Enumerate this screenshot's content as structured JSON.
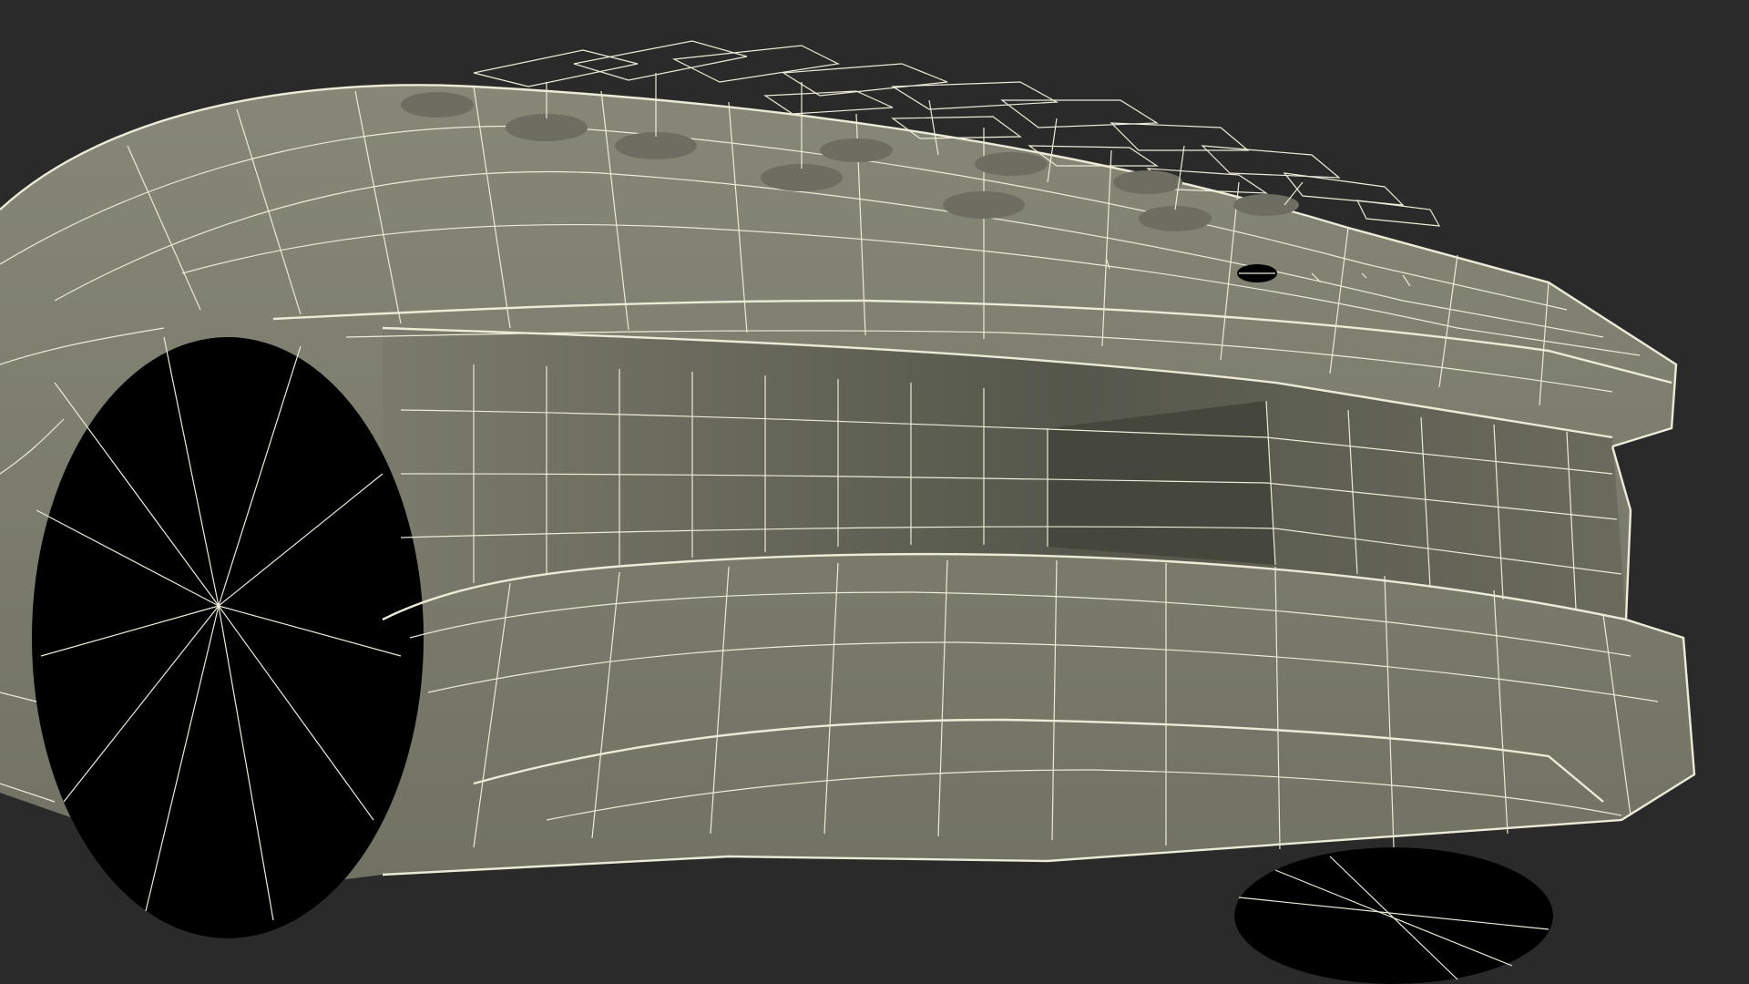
{
  "scene": {
    "background_color": "#2a2a2a",
    "surface_color": "#7a7b6c",
    "surface_shadow_color": "#5b5c50",
    "wire_color": "#ecebd6",
    "subject": "wireframe-concept-vehicle-rear-view"
  }
}
